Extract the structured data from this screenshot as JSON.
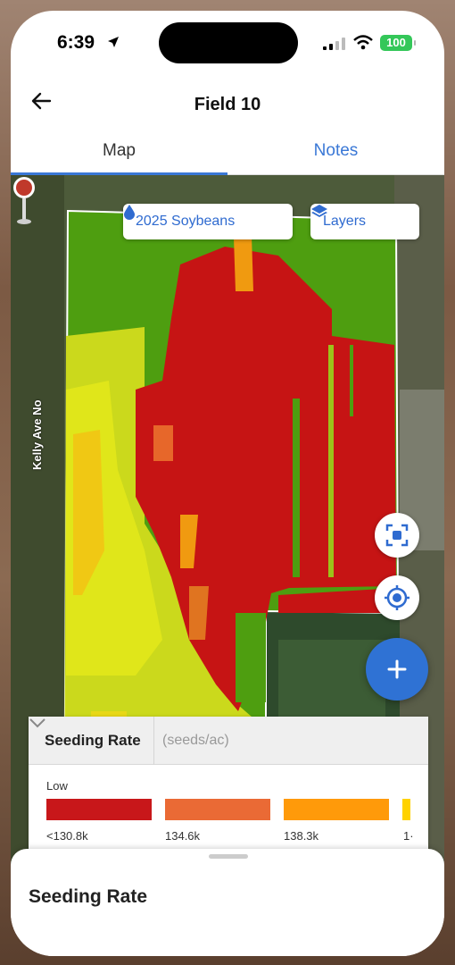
{
  "status_bar": {
    "time": "6:39",
    "battery": "100",
    "icons": [
      "location-arrow-icon",
      "signal-icon",
      "wifi-icon",
      "battery-icon"
    ]
  },
  "header": {
    "title": "Field 10",
    "back_icon": "back-arrow-icon"
  },
  "tabs": [
    {
      "label": "Map",
      "active": true
    },
    {
      "label": "Notes",
      "active": false
    }
  ],
  "map": {
    "crop_chip": {
      "label": "2025 Soybeans",
      "icon": "drop-icon"
    },
    "layers_chip": {
      "label": "Layers",
      "icon": "layers-icon"
    },
    "road_label": "Kelly Ave No",
    "buttons": [
      "focus-icon",
      "locate-icon"
    ],
    "fab_icon": "plus-icon",
    "colors": {
      "red": "#c61414",
      "green": "#4e9e10",
      "yellow": "#d7e31a",
      "orange": "#f09a10"
    }
  },
  "legend": {
    "title": "Seeding Rate",
    "unit": "(seeds/ac)",
    "low_label": "Low",
    "buckets": [
      {
        "label": "<130.8k",
        "color": "#c8171a"
      },
      {
        "label": "134.6k",
        "color": "#ea6a35"
      },
      {
        "label": "138.3k",
        "color": "#ff9a0a"
      },
      {
        "label": "1·",
        "color": "#ffd200"
      }
    ]
  },
  "bottom_sheet": {
    "title": "Seeding Rate"
  }
}
